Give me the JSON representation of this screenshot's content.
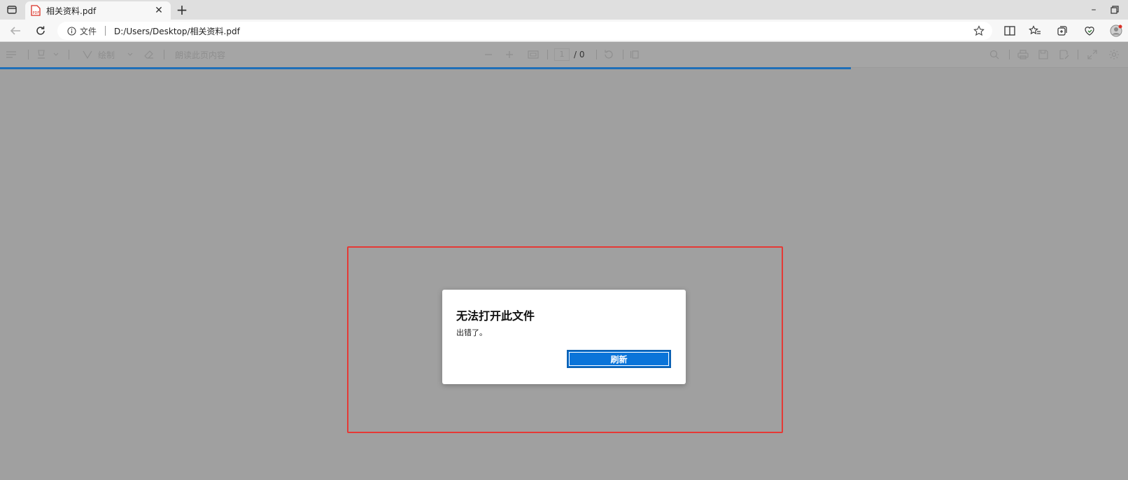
{
  "tab": {
    "title": "相关资料.pdf",
    "close_glyph": "✕",
    "icon": "pdf-file-icon"
  },
  "window": {
    "new_tab_glyph": "+",
    "minimize_glyph": "–"
  },
  "address_bar": {
    "site_info_label": "文件",
    "url": "D:/Users/Desktop/相关资料.pdf"
  },
  "pdf_toolbar": {
    "draw_label": "绘制",
    "read_aloud_label": "朗读此页内容",
    "page_current": "1",
    "page_total": "/ 0"
  },
  "dialog": {
    "title": "无法打开此文件",
    "message": "出错了。",
    "refresh_label": "刷新"
  },
  "colors": {
    "accent": "#0a74d9",
    "highlight": "#e53935",
    "viewer_background": "#a0a0a0"
  }
}
